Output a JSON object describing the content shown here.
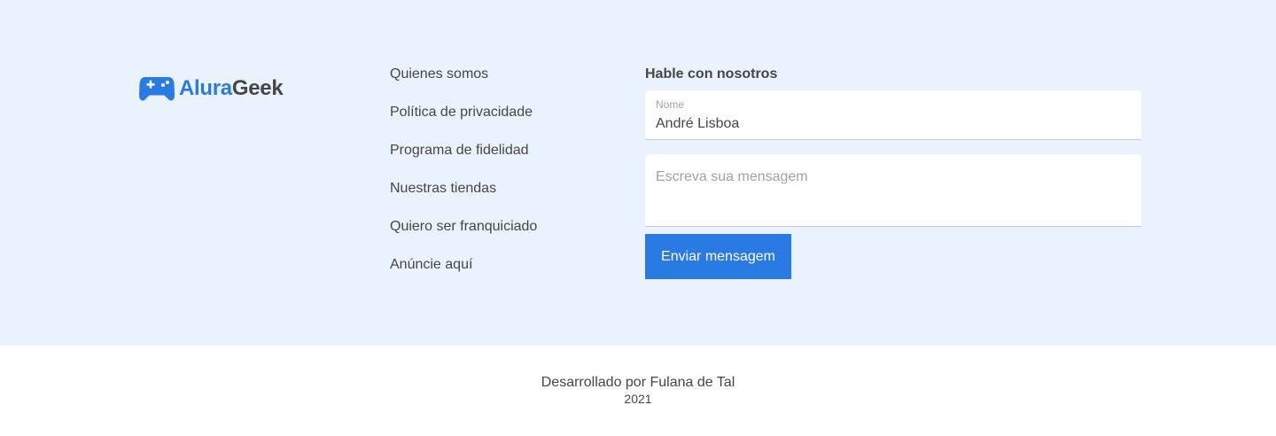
{
  "colors": {
    "background_top": "#EAF2FD",
    "background_bottom": "#FFFFFF",
    "accent": "#2A7AE4",
    "text": "#464646",
    "placeholder": "#A2A2A2"
  },
  "logo": {
    "icon": "gamepad-icon",
    "brand_part_1": "Alura",
    "brand_part_2": "Geek"
  },
  "links": [
    "Quienes somos",
    "Política de privacidade",
    "Programa de fidelidad",
    "Nuestras tiendas",
    "Quiero ser franquiciado",
    "Anúncie aquí"
  ],
  "contact": {
    "title": "Hable con nosotros",
    "name_label": "Nome",
    "name_value": "André Lisboa",
    "message_placeholder": "Escreva sua mensagem",
    "submit_label": "Enviar mensagem"
  },
  "footer": {
    "credit": "Desarrollado por Fulana de Tal",
    "year": "2021"
  }
}
